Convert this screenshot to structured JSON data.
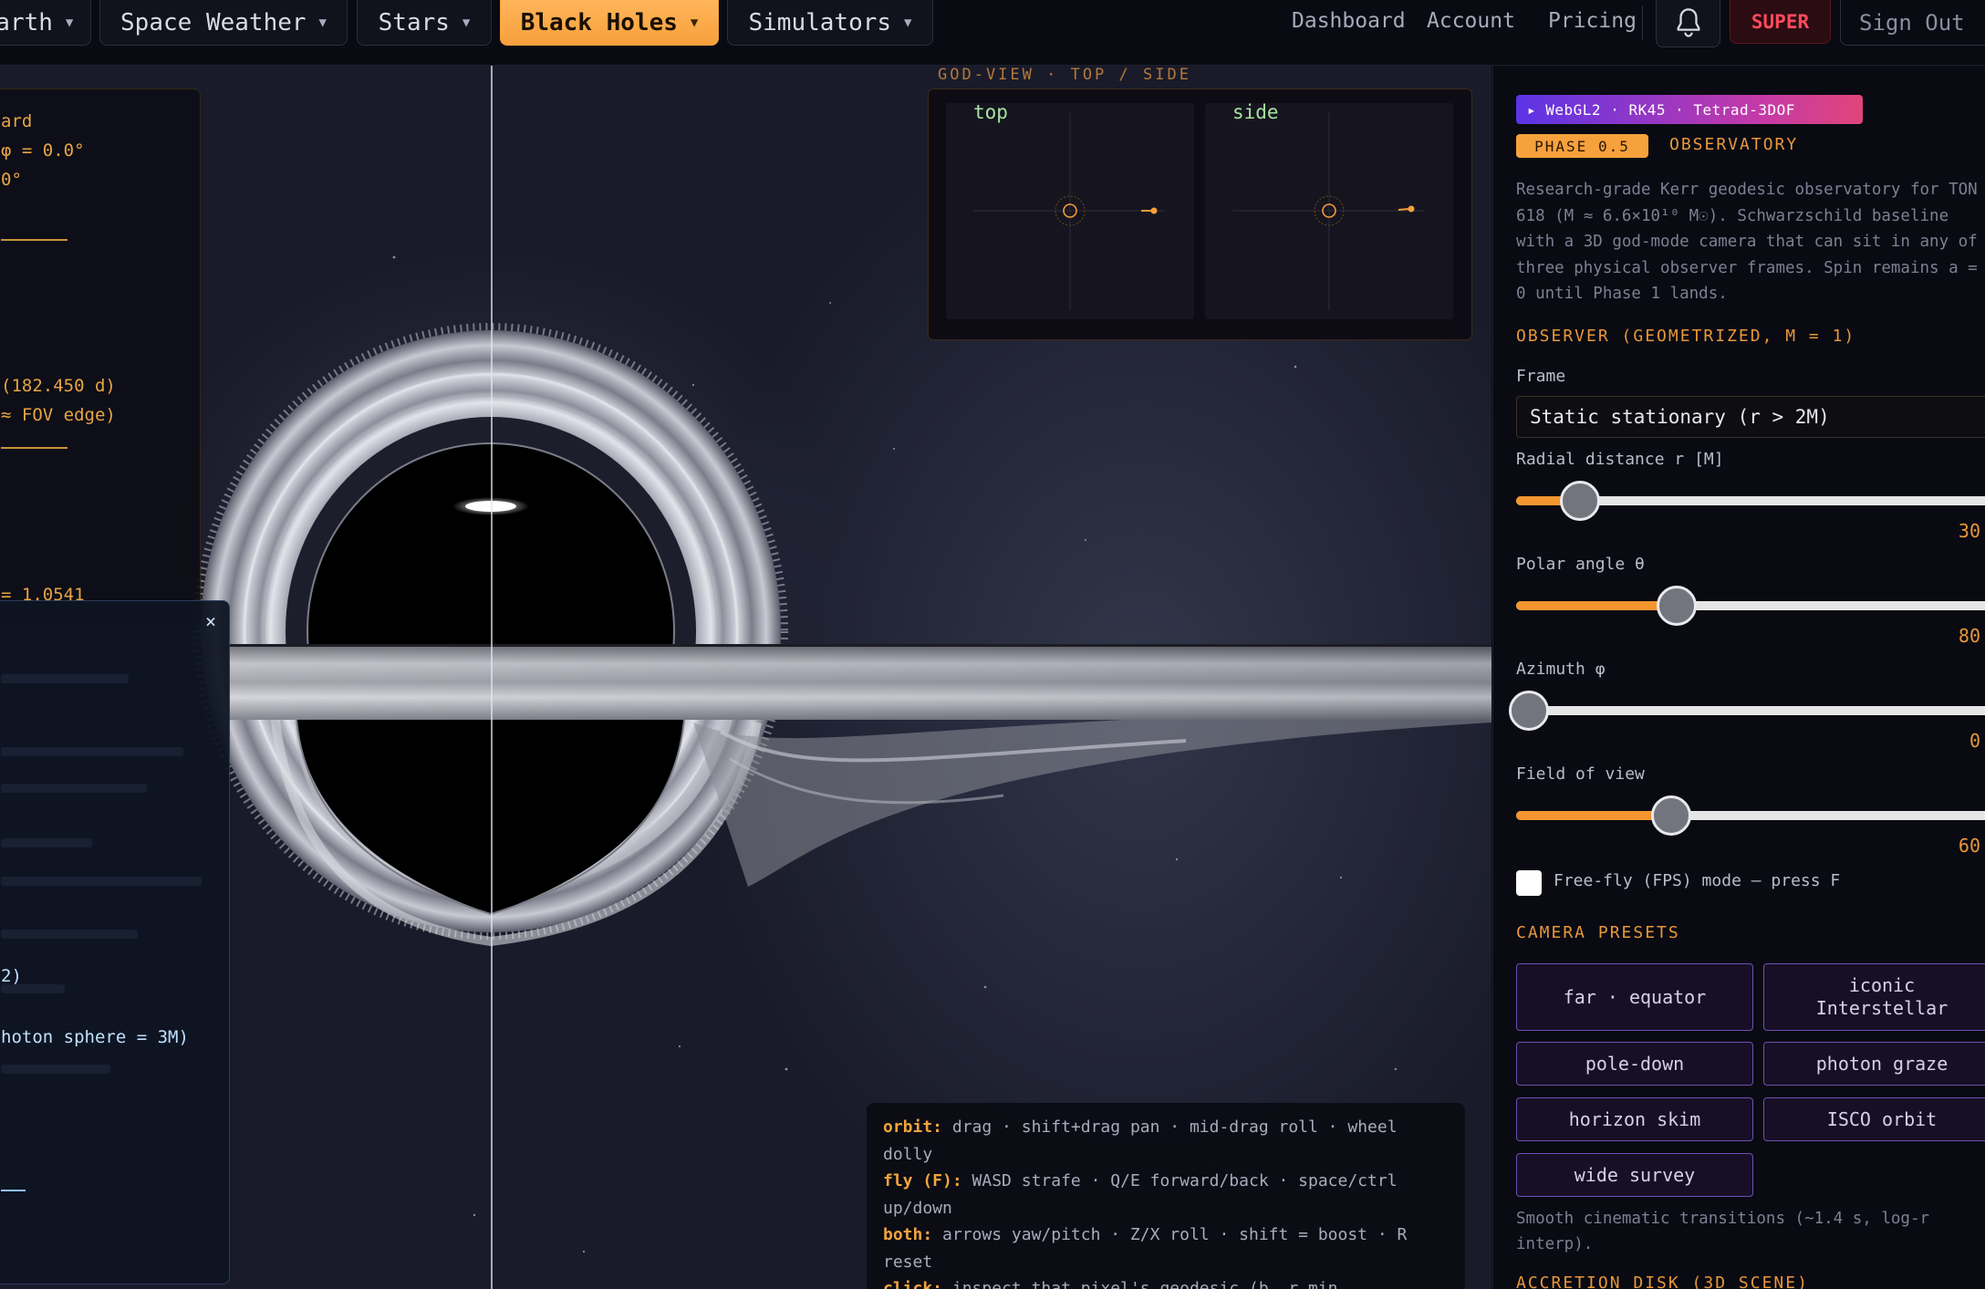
{
  "nav": {
    "tabs": [
      {
        "label": "Earth"
      },
      {
        "label": "Space Weather"
      },
      {
        "label": "Stars"
      },
      {
        "label": "Black Holes"
      },
      {
        "label": "Simulators"
      }
    ],
    "links": [
      "Dashboard",
      "Account",
      "Pricing"
    ],
    "super_label": "SUPER",
    "signout_label": "Sign Out"
  },
  "hud": {
    "lines": [
      "ard",
      "φ = 0.0°",
      "0°",
      "(182.450 d)",
      "≈ FOV edge)",
      "= 1.0541"
    ]
  },
  "dialog": {
    "close": "×",
    "lines": [
      "2)",
      "hoton sphere = 3M)"
    ]
  },
  "godview": {
    "title": "GOD-VIEW · TOP / SIDE",
    "top_label": "top",
    "side_label": "side"
  },
  "help": {
    "orbit_key": "orbit:",
    "orbit_text": "drag · shift+drag pan · mid-drag roll · wheel dolly",
    "fly_key": "fly (F):",
    "fly_text": "WASD strafe · Q/E forward/back · space/ctrl up/down",
    "both_key": "both:",
    "both_text": "arrows yaw/pitch · Z/X roll · shift = boost · R reset",
    "click_key": "click:",
    "click_text": "inspect that pixel's geodesic (b, r_min, ..."
  },
  "panel": {
    "tech_badge": "▸ WebGL2 · RK45 · Tetrad-3DOF",
    "phase_badge": "PHASE 0.5",
    "observatory": "OBSERVATORY",
    "description": "Research-grade Kerr geodesic observatory for TON 618 (M ≈ 6.6×10¹⁰ M☉). Schwarzschild baseline with a 3D god-mode camera that can sit in any of three physical observer frames. Spin remains a = 0 until Phase 1 lands.",
    "observer_heading": "OBSERVER (GEOMETRIZED, M = 1)",
    "frame_label": "Frame",
    "frame_value": "Static stationary (r > 2M)",
    "sliders": [
      {
        "label": "Radial distance r [M]",
        "value": "30",
        "fraction": 0.12
      },
      {
        "label": "Polar angle θ",
        "value": "80",
        "fraction": 0.32
      },
      {
        "label": "Azimuth φ",
        "value": "0",
        "fraction": 0.0
      },
      {
        "label": "Field of view",
        "value": "60",
        "fraction": 0.31
      }
    ],
    "freefly_label": "Free-fly (FPS) mode — press F",
    "presets_heading": "CAMERA PRESETS",
    "presets": [
      "far · equator",
      "iconic Interstellar",
      "pole-down",
      "photon graze",
      "horizon skim",
      "ISCO orbit",
      "wide survey"
    ],
    "presets_note": "Smooth cinematic transitions (~1.4 s, log-r interp).",
    "disk_heading": "ACCRETION DISK (3D SCENE)"
  },
  "colors": {
    "accent": "#f5952f",
    "active_tab": "#f7a03c",
    "super": "#ff4b5c",
    "preset_border": "#6e4fb2"
  }
}
